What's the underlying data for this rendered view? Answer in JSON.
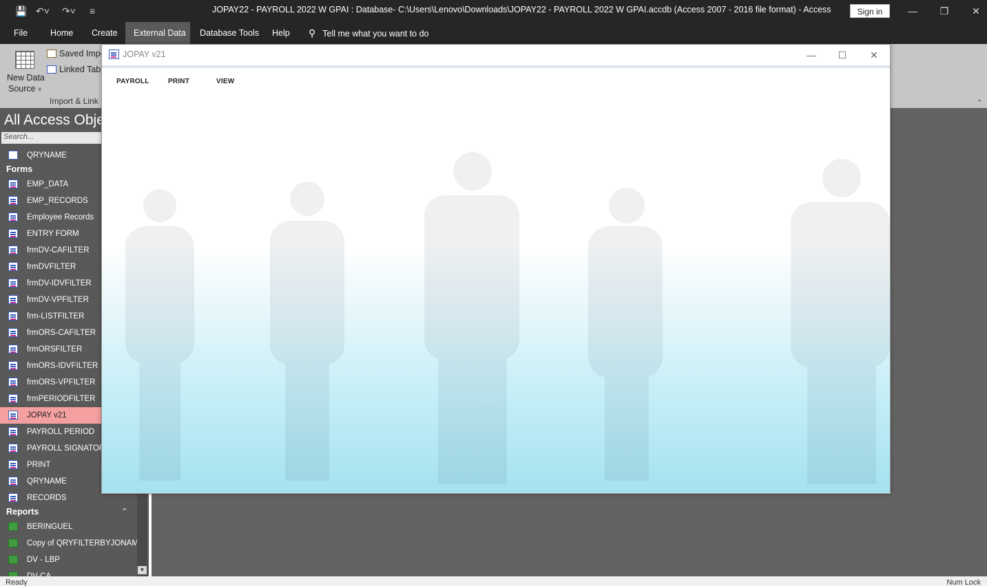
{
  "app": {
    "title": "JOPAY22 - PAYROLL 2022 W GPAI : Database- C:\\Users\\Lenovo\\Downloads\\JOPAY22 - PAYROLL 2022 W GPAI.accdb (Access 2007 - 2016 file format)  -  Access",
    "sign_in": "Sign in"
  },
  "menu": {
    "items": [
      "File",
      "Home",
      "Create",
      "External Data",
      "Database Tools",
      "Help"
    ],
    "active": "External Data",
    "tell_me": "Tell me what you want to do"
  },
  "ribbon": {
    "new_data_source": "New Data",
    "new_data_source_line2": "Source",
    "saved_imports": "Saved Impo",
    "linked_table": "Linked Tabl",
    "group_label": "Import & Link"
  },
  "nav": {
    "title": "All Access Obje",
    "search_placeholder": "Search...",
    "query_top": "QRYNAME",
    "forms_header": "Forms",
    "forms": [
      "EMP_DATA",
      "EMP_RECORDS",
      "Employee Records",
      "ENTRY FORM",
      "frmDV-CAFILTER",
      "frmDVFILTER",
      "frmDV-IDVFILTER",
      "frmDV-VPFILTER",
      "frm-LISTFILTER",
      "frmORS-CAFILTER",
      "frmORSFILTER",
      "frmORS-IDVFILTER",
      "frmORS-VPFILTER",
      "frmPERIODFILTER",
      "JOPAY v21",
      "PAYROLL PERIOD",
      "PAYROLL SIGNATORIE",
      "PRINT",
      "QRYNAME",
      "RECORDS"
    ],
    "selected_form": "JOPAY v21",
    "reports_header": "Reports",
    "reports": [
      "BERINGUEL",
      "Copy of QRYFILTERBYJONAME",
      "DV - LBP",
      "DV-CA"
    ]
  },
  "form_window": {
    "title": "JOPAY v21",
    "buttons": [
      "PAYROLL",
      "PRINT",
      "VIEW"
    ]
  },
  "status": {
    "left": "Ready",
    "right": "Num Lock"
  },
  "colors": {
    "titlebar": "#262626",
    "ribbon": "#c6c6c6",
    "navpane": "#595959",
    "selected_item": "#f4a0a0",
    "workspace": "#636363"
  }
}
